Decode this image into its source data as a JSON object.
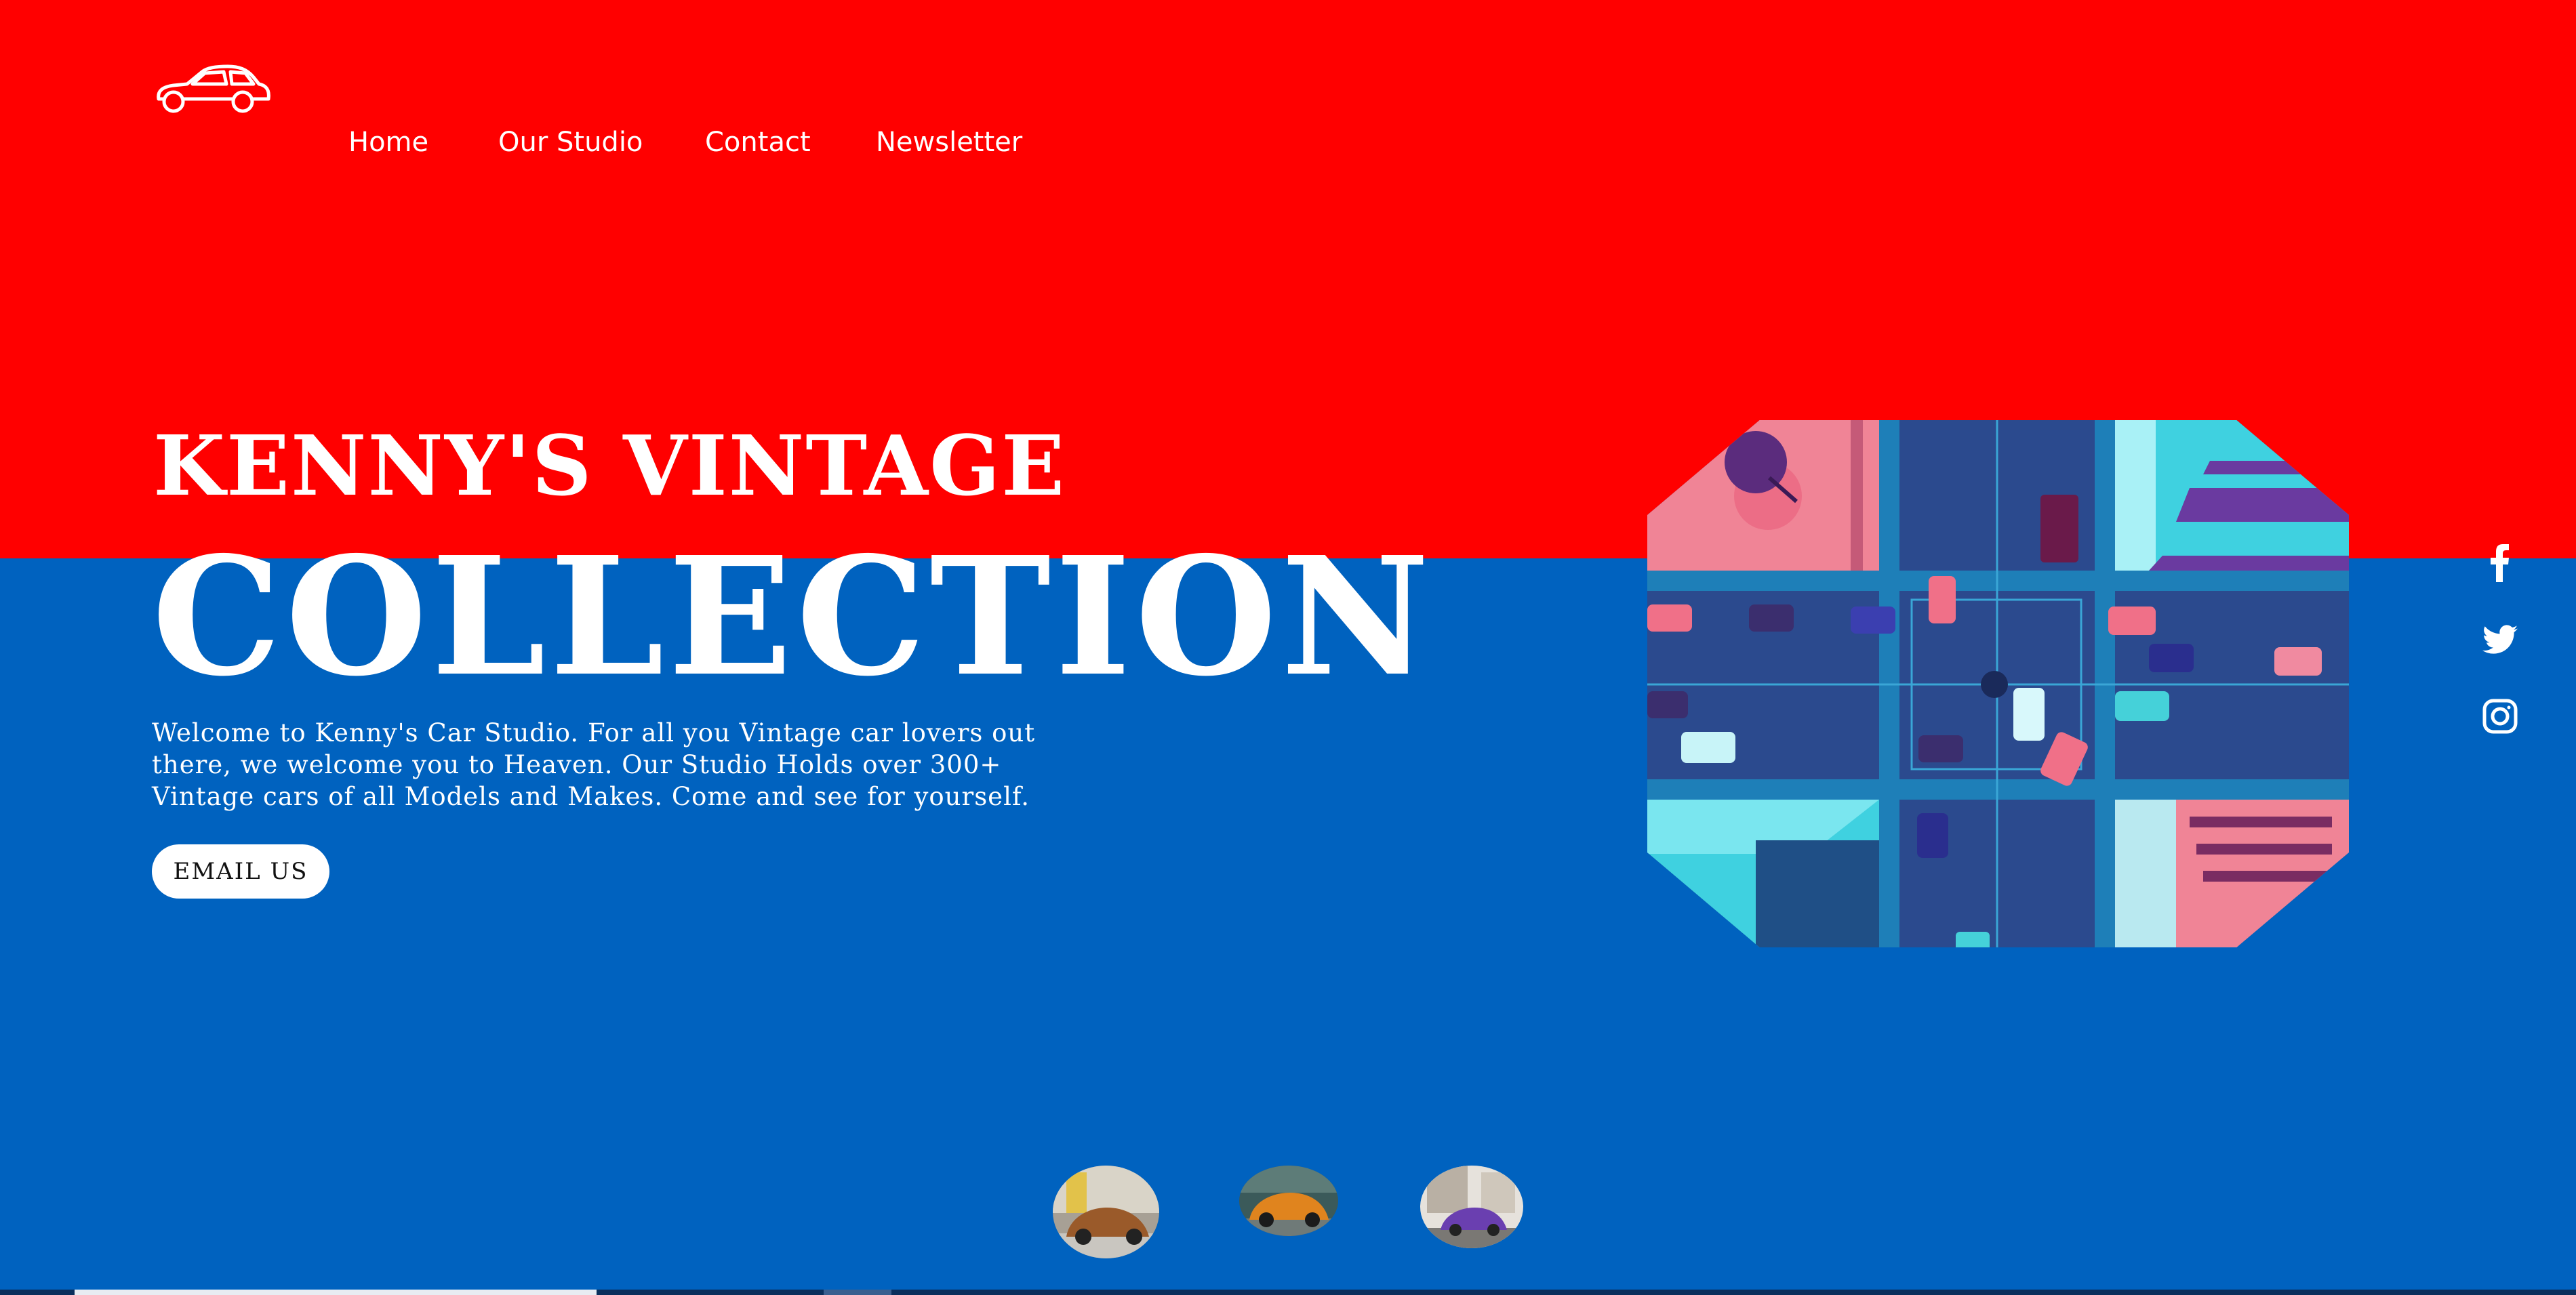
{
  "nav": {
    "items": [
      {
        "label": "Home"
      },
      {
        "label": "Our Studio"
      },
      {
        "label": "Contact"
      },
      {
        "label": "Newsletter"
      }
    ]
  },
  "logo": {
    "icon": "car-outline-icon"
  },
  "hero": {
    "title_line1": "KENNY'S VINTAGE",
    "title_line2": "COLLECTION",
    "text": "Welcome to Kenny's Car Studio. For all you Vintage car lovers out there, we welcome you to Heaven. Our Studio Holds over 300+ Vintage cars of all Models and Makes. Come and see for yourself.",
    "cta_label": "EMAIL US"
  },
  "social": {
    "icons": [
      "facebook-icon",
      "twitter-icon",
      "instagram-icon"
    ]
  },
  "colors": {
    "top_band": "#ff0000",
    "bottom_band": "#0062bf",
    "text": "#ffffff"
  }
}
